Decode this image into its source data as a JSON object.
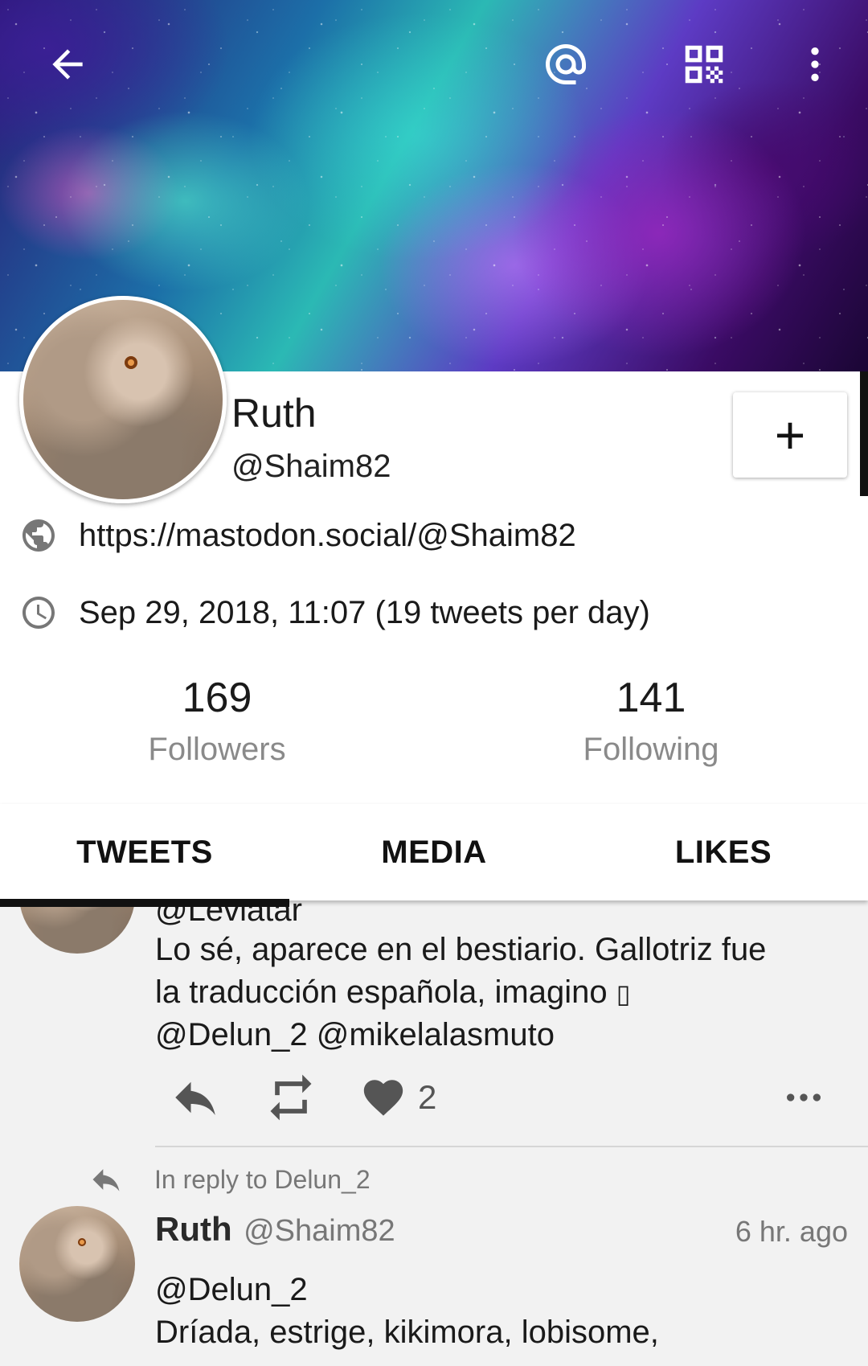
{
  "topbar": {
    "back_icon": "arrow-back-icon",
    "mention_icon": "at-sign-icon",
    "qr_icon": "qr-code-icon",
    "overflow_icon": "more-vert-icon"
  },
  "profile": {
    "display_name": "Ruth",
    "username": "@Shaim82",
    "follow_button_label": "+",
    "website": "https://mastodon.social/@Shaim82",
    "joined": "Sep 29, 2018, 11:07 (19 tweets per day)"
  },
  "stats": {
    "followers_count": "169",
    "followers_label": "Followers",
    "following_count": "141",
    "following_label": "Following"
  },
  "tabs": [
    {
      "label": "TWEETS",
      "active": true
    },
    {
      "label": "MEDIA",
      "active": false
    },
    {
      "label": "LIKES",
      "active": false
    }
  ],
  "feed": {
    "post1": {
      "mention_line": "@Leviatar",
      "text_line1": "Lo sé, aparece en el bestiario. Gallotriz fue",
      "text_line2": "la traducción española, imagino ",
      "text_line2_glyph": "▯",
      "text_line3": "@Delun_2 @mikelalasmuto",
      "like_count": "2"
    },
    "post2": {
      "reply_to": "In reply to Delun_2",
      "author_name": "Ruth",
      "author_handle": "@Shaim82",
      "time": "6 hr. ago",
      "text_line1": "@Delun_2",
      "text_line2": "Dríada, estrige, kikimora, lobisome,"
    }
  },
  "colors": {
    "card_bg": "#ffffff",
    "feed_bg": "#f2f2f2",
    "text_primary": "#1a1a1a",
    "text_secondary": "#8a8a8a",
    "tab_indicator": "#111111"
  }
}
